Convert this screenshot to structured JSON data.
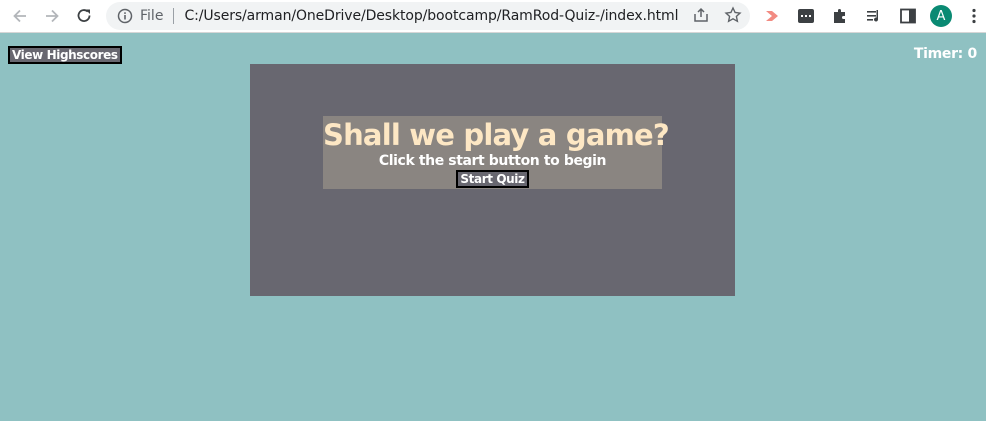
{
  "browser": {
    "scheme_label": "File",
    "url": "C:/Users/arman/OneDrive/Desktop/bootcamp/RamRod-Quiz-/index.html",
    "profile_initial": "A",
    "colors": {
      "toolbar_bg": "#ffffff",
      "omnibox_bg": "#f1f3f4",
      "avatar_bg": "#0a8a73"
    },
    "icons": [
      "back-arrow-icon",
      "forward-arrow-icon",
      "reload-icon",
      "info-icon",
      "share-icon",
      "star-icon",
      "extension-red-icon",
      "extension-dark-icon",
      "puzzle-icon",
      "media-icon",
      "side-panel-icon",
      "kebab-menu-icon"
    ]
  },
  "page": {
    "highscores_label": "View Highscores",
    "timer_text": "Timer: 0",
    "intro": {
      "title": "Shall we play a game?",
      "subtitle": "Click the start button to begin",
      "start_label": "Start Quiz"
    },
    "colors": {
      "page_bg": "#8fc1c2",
      "panel_bg": "#686770",
      "card_bg": "#8a8581",
      "title_color": "#fde7c4",
      "text_color": "#ffffff"
    }
  }
}
